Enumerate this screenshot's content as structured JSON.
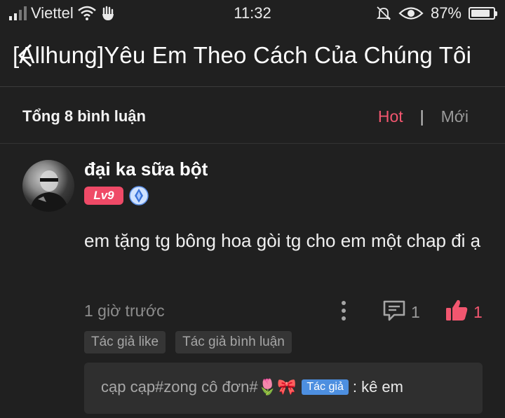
{
  "status_bar": {
    "carrier": "Viettel",
    "time": "11:32",
    "battery": "87%",
    "battery_level": 0.87
  },
  "header": {
    "title": "[Allhung]Yêu Em Theo Cách Của Chúng Tôi"
  },
  "comments_header": {
    "count_label": "Tổng 8 bình luận",
    "sort_hot": "Hot",
    "sort_separator": "|",
    "sort_new": "Mới"
  },
  "comment": {
    "username": "đại ka sữa bột",
    "level": "Lv9",
    "content": "em tặng tg bông hoa gòi tg cho em một chap đi ạ",
    "time": "1 giờ trước",
    "reply_count": "1",
    "like_count": "1",
    "tags": [
      "Tác giả like",
      "Tác giả bình luận"
    ],
    "reply": {
      "user": "cạp cạp#zong cô đơn#🌷🎀",
      "author_badge": "Tác giả",
      "text": ": kê em"
    }
  },
  "colors": {
    "background": "#202020",
    "accent_pink": "#f2566f",
    "author_blue": "#4d8fe0"
  }
}
